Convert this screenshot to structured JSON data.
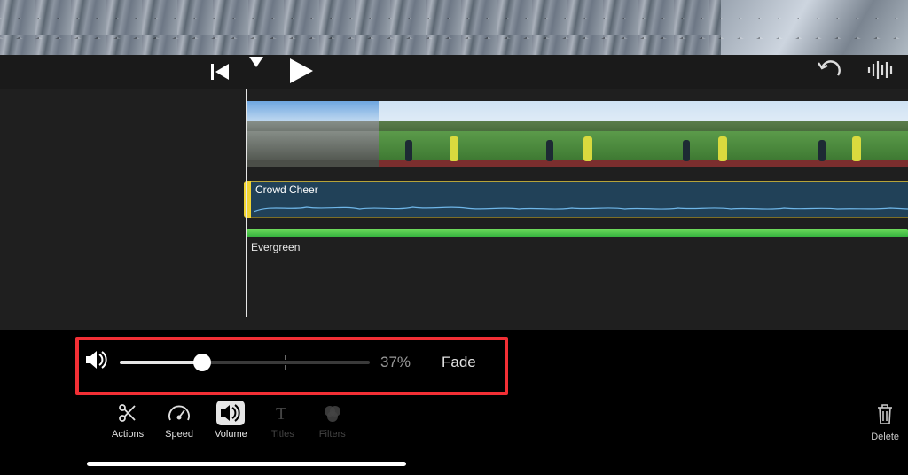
{
  "transport": {
    "prev_icon": "skip-back-icon",
    "play_icon": "play-icon",
    "undo_icon": "undo-icon",
    "waveform_icon": "waveform-icon"
  },
  "timeline": {
    "audio1": {
      "title": "Crowd Cheer"
    },
    "audio2": {
      "title": "Evergreen"
    }
  },
  "volume": {
    "percent_label": "37%",
    "percent_value": 37,
    "fade_label": "Fade",
    "slider_fill_pct": 33
  },
  "toolbar": {
    "items": [
      {
        "key": "actions",
        "label": "Actions",
        "icon": "scissors-icon",
        "enabled": true,
        "active": false
      },
      {
        "key": "speed",
        "label": "Speed",
        "icon": "speedometer-icon",
        "enabled": true,
        "active": false
      },
      {
        "key": "volume",
        "label": "Volume",
        "icon": "volume-icon",
        "enabled": true,
        "active": true
      },
      {
        "key": "titles",
        "label": "Titles",
        "icon": "titles-icon",
        "enabled": false,
        "active": false
      },
      {
        "key": "filters",
        "label": "Filters",
        "icon": "filters-icon",
        "enabled": false,
        "active": false
      }
    ]
  },
  "delete": {
    "label": "Delete"
  }
}
